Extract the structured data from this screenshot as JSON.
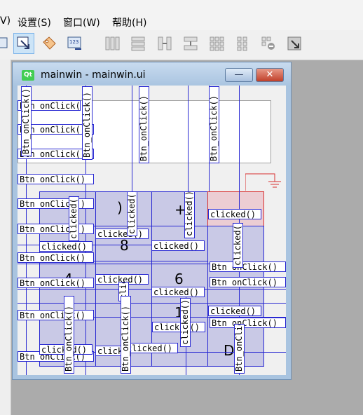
{
  "menubar": {
    "items": [
      "V)",
      "设置(S)",
      "窗口(W)",
      "帮助(H)"
    ]
  },
  "toolbar": {
    "icons": [
      "widget-editor-icon",
      "signal-slot-editor-icon",
      "buddy-editor-icon",
      "tab-order-editor-icon",
      "layout-horizontal-icon",
      "layout-vertical-icon",
      "layout-horizontal-splitter-icon",
      "layout-vertical-splitter-icon",
      "layout-grid-icon",
      "layout-form-icon",
      "break-layout-icon",
      "adjust-size-icon"
    ]
  },
  "window": {
    "badge": "Qt",
    "title": "mainwin - mainwin.ui",
    "minimize": "—",
    "close": "✕"
  },
  "keys": {
    "rparen": ")",
    "plus": "+",
    "eight": "8",
    "six": "6",
    "four": "4",
    "one": "1",
    "d": "D"
  },
  "labels": {
    "btn_onclick": "Btn_onClick()",
    "clicked": "clicked()",
    "click_partial": "click"
  }
}
